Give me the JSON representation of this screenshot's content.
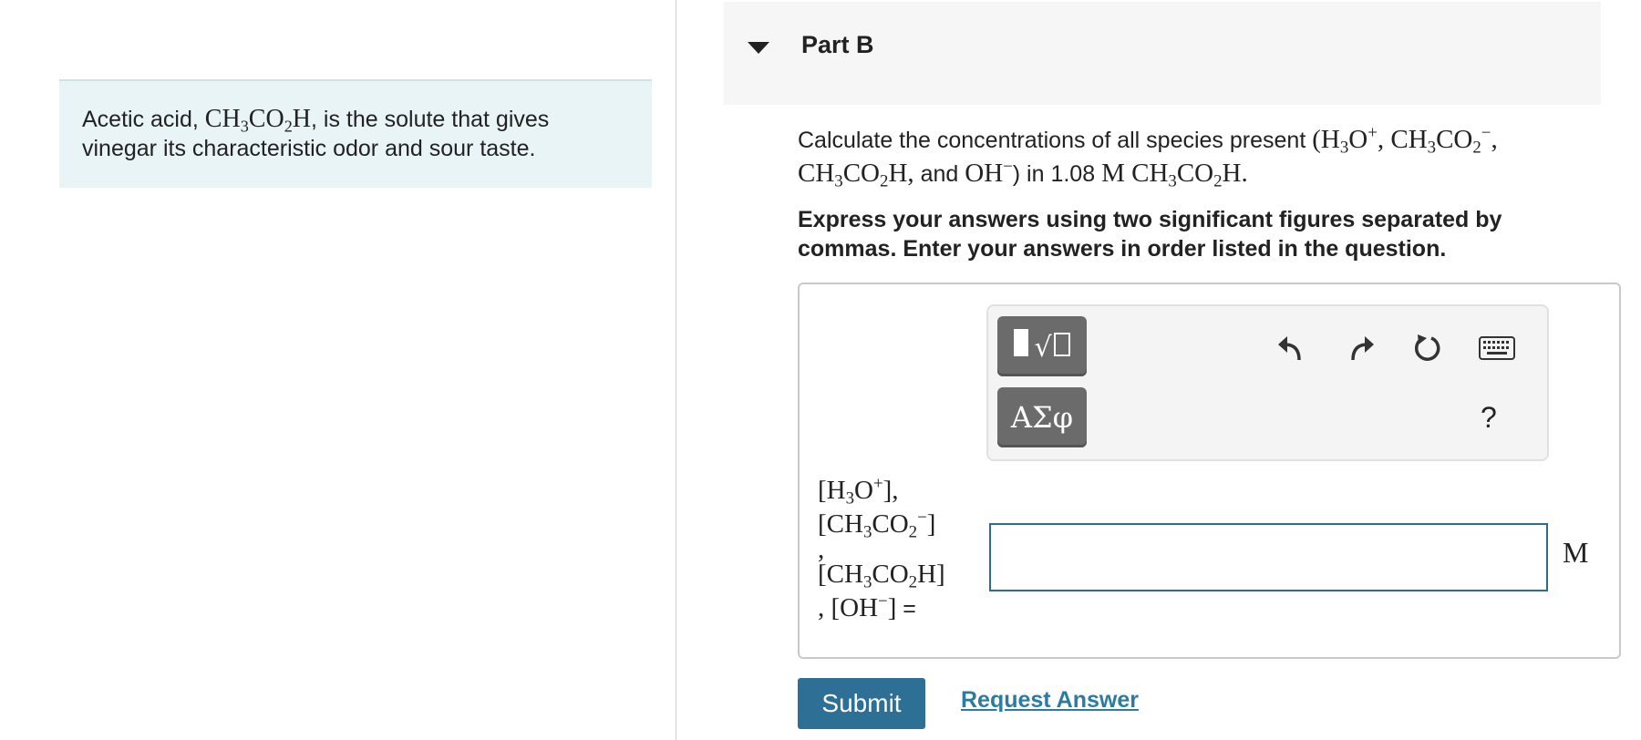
{
  "intro": {
    "pre": "Acetic acid, ",
    "formula": {
      "a": "CH",
      "a_sub": "3",
      "b": "CO",
      "b_sub": "2",
      "c": "H"
    },
    "post": ", is the solute that gives vinegar its characteristic odor and sour taste."
  },
  "part": {
    "title": "Part B"
  },
  "question": {
    "t1": "Calculate the concentrations of all species present ",
    "open_paren": "(",
    "h3o": {
      "a": "H",
      "a_sub": "3",
      "b": "O",
      "sup": "+"
    },
    "comma1": ", ",
    "acetate": {
      "a": "CH",
      "a_sub": "3",
      "b": "CO",
      "b_sub": "2",
      "sup": "−"
    },
    "comma2": ",",
    "acid": {
      "a": "CH",
      "a_sub": "3",
      "b": "CO",
      "b_sub": "2",
      "c": "H"
    },
    "comma3": ",",
    "t2": " and ",
    "oh": {
      "a": "OH",
      "sup": "−"
    },
    "close_paren": ")",
    "t3": " in 1.08 ",
    "molar": "M",
    "acid2": {
      "a": "CH",
      "a_sub": "3",
      "b": "CO",
      "b_sub": "2",
      "c": "H"
    },
    "period": "."
  },
  "instructions": "Express your answers using two significant figures separated by commas. Enter your answers in order listed in the question.",
  "toolbar": {
    "greek_label": "ΑΣφ",
    "help_label": "?",
    "icons": [
      "templates-icon",
      "undo-icon",
      "redo-icon",
      "reset-icon",
      "keyboard-icon"
    ]
  },
  "answer": {
    "label": {
      "l1": "[H",
      "l1_sub": "3",
      "l1b": "O",
      "l1_sup": "+",
      "l1_end": "],",
      "l2": "[CH",
      "l2_sub": "3",
      "l2b": "CO",
      "l2_sub2": "2",
      "l2_sup": "−",
      "l2_end": "]",
      "l3": ",",
      "l4": "[CH",
      "l4_sub": "3",
      "l4b": "CO",
      "l4_sub2": "2",
      "l4c": "H]",
      "l5a": ", [OH",
      "l5_sup": "−",
      "l5b": "]",
      "eq": " ="
    },
    "value": "",
    "placeholder": "",
    "unit": "M"
  },
  "buttons": {
    "submit": "Submit",
    "request_answer": "Request Answer"
  },
  "colors": {
    "intro_bg": "#e9f4f7",
    "submit_bg": "#2e6f95",
    "link": "#2b7ba3",
    "input_border": "#2e6c8e",
    "tool_button": "#6b6b6b"
  }
}
